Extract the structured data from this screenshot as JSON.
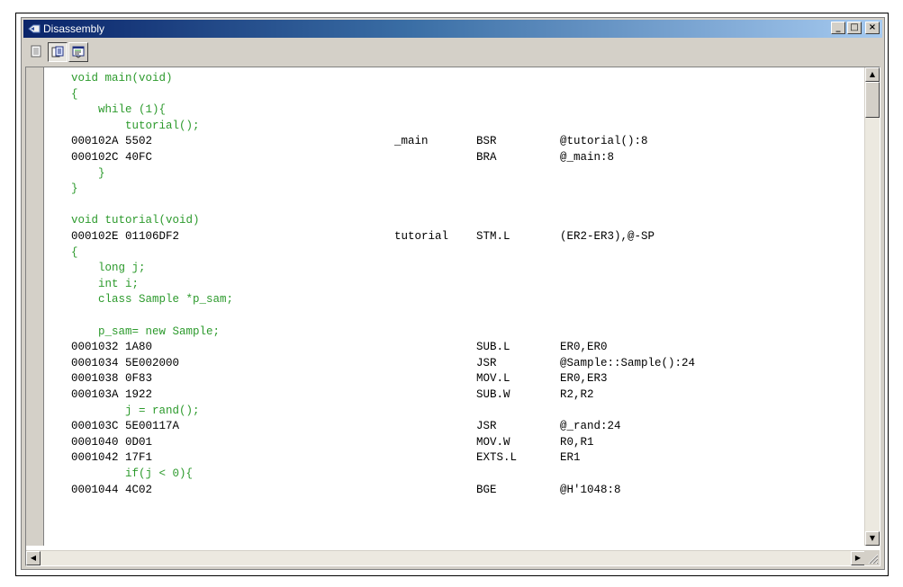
{
  "window": {
    "title": "Disassembly",
    "controls": {
      "minimize": "_",
      "maximize": "□",
      "close": "×"
    }
  },
  "toolbar": {
    "buttons": [
      {
        "name": "source-view-icon",
        "state": "raised"
      },
      {
        "name": "mixed-view-icon",
        "state": "pressed"
      },
      {
        "name": "disassembly-view-icon",
        "state": "raised"
      }
    ]
  },
  "colors": {
    "source": "#2c9a2c",
    "asm": "#000000",
    "title_start": "#0a246a",
    "pc_marker": "#e8c010"
  },
  "lines": [
    {
      "type": "src",
      "text": "void main(void)"
    },
    {
      "type": "src",
      "text": "{"
    },
    {
      "type": "src",
      "text": "    while (1){"
    },
    {
      "type": "src",
      "text": "        tutorial();"
    },
    {
      "type": "asm",
      "addr": "000102A 5502",
      "label": "_main",
      "mnemonic": "BSR",
      "operands": "@tutorial():8"
    },
    {
      "type": "asm",
      "addr": "000102C 40FC",
      "label": "",
      "mnemonic": "BRA",
      "operands": "@_main:8"
    },
    {
      "type": "src",
      "text": "    }"
    },
    {
      "type": "src",
      "text": "}"
    },
    {
      "type": "src",
      "text": ""
    },
    {
      "type": "src",
      "text": "void tutorial(void)"
    },
    {
      "type": "asm",
      "addr": "000102E 01106DF2",
      "label": "tutorial",
      "mnemonic": "STM.L",
      "operands": "(ER2-ER3),@-SP"
    },
    {
      "type": "src",
      "text": "{"
    },
    {
      "type": "src",
      "text": "    long j;"
    },
    {
      "type": "src",
      "text": "    int i;"
    },
    {
      "type": "src",
      "text": "    class Sample *p_sam;"
    },
    {
      "type": "src",
      "text": ""
    },
    {
      "type": "src",
      "text": "    p_sam= new Sample;"
    },
    {
      "type": "asm",
      "addr": "0001032 1A80",
      "label": "",
      "mnemonic": "SUB.L",
      "operands": "ER0,ER0",
      "pc": true
    },
    {
      "type": "asm",
      "addr": "0001034 5E002000",
      "label": "",
      "mnemonic": "JSR",
      "operands": "@Sample::Sample():24"
    },
    {
      "type": "asm",
      "addr": "0001038 0F83",
      "label": "",
      "mnemonic": "MOV.L",
      "operands": "ER0,ER3"
    },
    {
      "type": "asm",
      "addr": "000103A 1922",
      "label": "",
      "mnemonic": "SUB.W",
      "operands": "R2,R2"
    },
    {
      "type": "src",
      "text": "        j = rand();"
    },
    {
      "type": "asm",
      "addr": "000103C 5E00117A",
      "label": "",
      "mnemonic": "JSR",
      "operands": "@_rand:24"
    },
    {
      "type": "asm",
      "addr": "0001040 0D01",
      "label": "",
      "mnemonic": "MOV.W",
      "operands": "R0,R1"
    },
    {
      "type": "asm",
      "addr": "0001042 17F1",
      "label": "",
      "mnemonic": "EXTS.L",
      "operands": "ER1"
    },
    {
      "type": "src",
      "text": "        if(j < 0){"
    },
    {
      "type": "asm",
      "addr": "0001044 4C02",
      "label": "",
      "mnemonic": "BGE",
      "operands": "@H'1048:8"
    }
  ]
}
